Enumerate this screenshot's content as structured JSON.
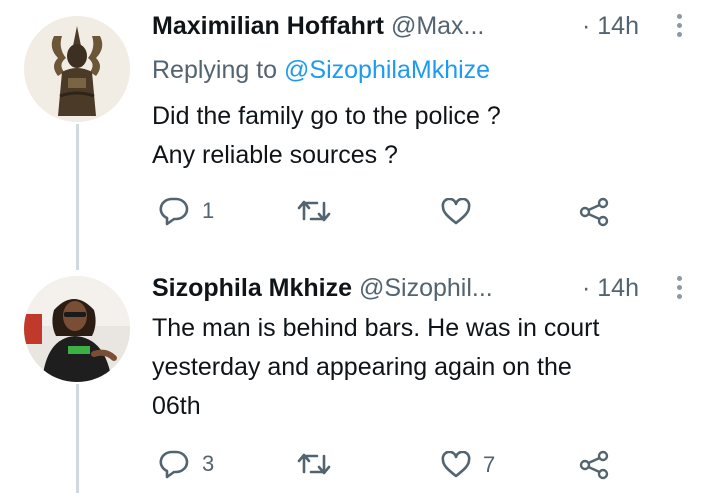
{
  "tweets": [
    {
      "name": "Maximilian Hoffahrt",
      "handle": "@Max...",
      "time": "· 14h",
      "replying_prefix": "Replying to",
      "replying_to": "@SizophilaMkhize",
      "lines": [
        "Did the family go to the police ?",
        "Any reliable sources ?"
      ],
      "reply_count": "1",
      "retweet_count": "",
      "like_count": ""
    },
    {
      "name": "Sizophila Mkhize",
      "handle": "@Sizophil...",
      "time": "· 14h",
      "lines": [
        "The man is behind bars. He was in court",
        "yesterday and appearing again on the",
        "06th"
      ],
      "reply_count": "3",
      "retweet_count": "",
      "like_count": "7"
    }
  ],
  "icons": {
    "reply": "reply-icon",
    "retweet": "retweet-icon",
    "like": "heart-icon",
    "share": "share-icon",
    "more": "more-icon"
  },
  "colors": {
    "text": "#0f1419",
    "secondary": "#536471",
    "link": "#1d9bf0",
    "thread_line": "#cfd9de"
  }
}
